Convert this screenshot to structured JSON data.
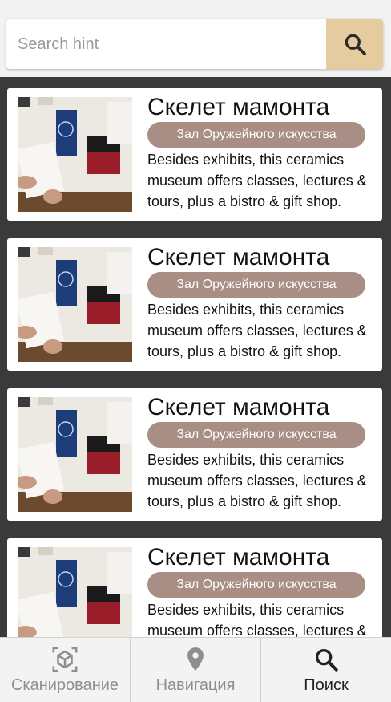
{
  "search": {
    "placeholder": "Search hint"
  },
  "cards": [
    {
      "title": "Скелет мамонта",
      "badge": "Зал Оружейного искусства",
      "description": "Besides exhibits, this ceramics museum offers classes, lectures & tours, plus a bistro & gift shop."
    },
    {
      "title": "Скелет мамонта",
      "badge": "Зал Оружейного искусства",
      "description": "Besides exhibits, this ceramics museum offers classes, lectures & tours, plus a bistro & gift shop."
    },
    {
      "title": "Скелет мамонта",
      "badge": "Зал Оружейного искусства",
      "description": "Besides exhibits, this ceramics museum offers classes, lectures & tours, plus a bistro & gift shop."
    },
    {
      "title": "Скелет мамонта",
      "badge": "Зал Оружейного искусства",
      "description": "Besides exhibits, this ceramics museum offers classes, lectures & tours, plus a bistro & gift shop."
    }
  ],
  "bottom_nav": {
    "items": [
      {
        "label": "Сканирование",
        "icon": "ar-cube-icon"
      },
      {
        "label": "Навигация",
        "icon": "location-pin-icon"
      },
      {
        "label": "Поиск",
        "icon": "search-icon",
        "active": true
      }
    ]
  },
  "colors": {
    "search_button": "#e4cc9f",
    "badge": "#a88e84",
    "background": "#3a3a3a"
  }
}
